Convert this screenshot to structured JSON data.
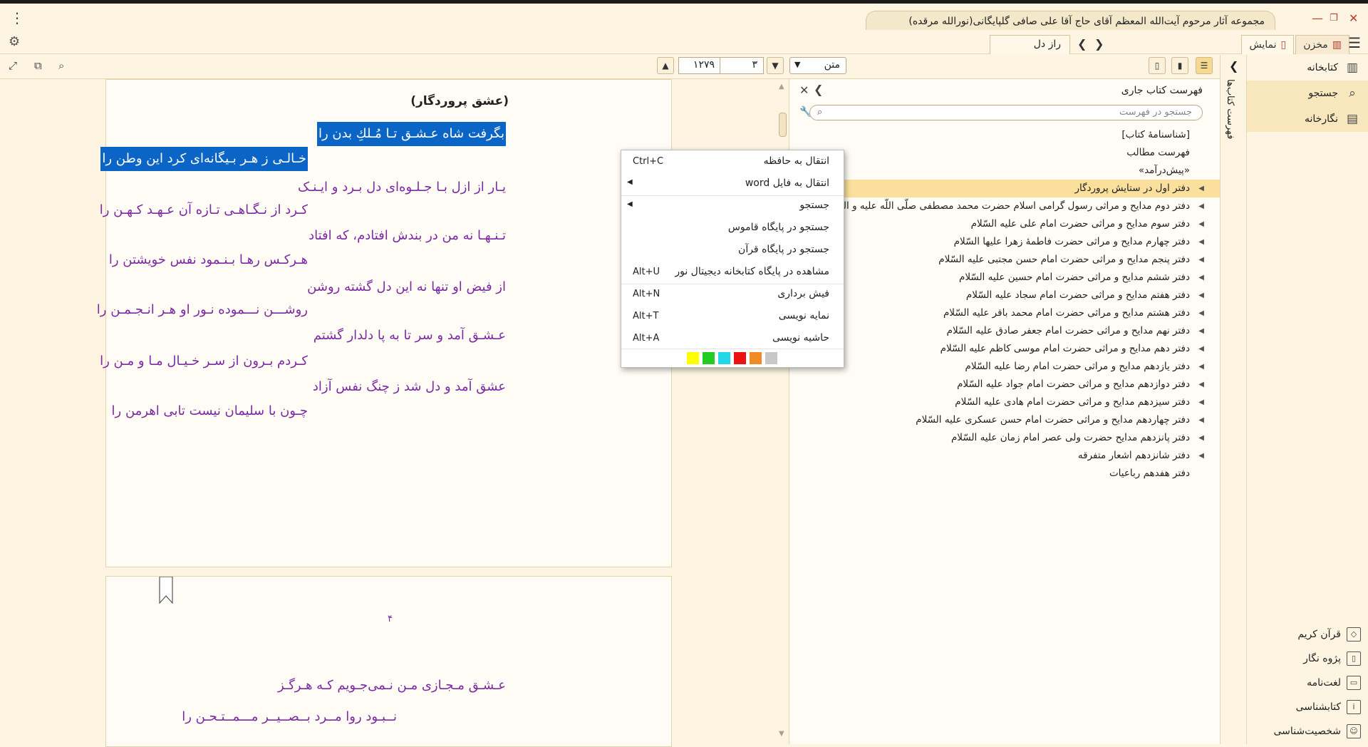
{
  "app": {
    "window_title": "مجموعه آثار مرحوم آیت‌الله المعظم آقای حاج آقا علی صافی گلپایگانی(نورالله مرقده)",
    "new_tab": "+",
    "menu_dots": "⋮"
  },
  "tabs": {
    "storage": "مخزن",
    "display": "نمایش",
    "bookmark_title": "راز دل"
  },
  "toolbar": {
    "view_mode": "متن",
    "page": "۳",
    "volume": "۱۲۷۹"
  },
  "poem": {
    "title": "(عشق پروردگار)",
    "page_number": "۴",
    "lines": [
      {
        "text": "بگرفت شاه عـشـق تـا مُـلكِ بدن را",
        "selected": true
      },
      {
        "text": "خـالـی ز هـر بـیگانه‌ای کرد این وطن را",
        "selected": true
      },
      {
        "text": "یـار از ازل بـا جـلـوه‌ای دل بـرد و ایـنـک",
        "selected": false
      },
      {
        "text": "کـرد از نـگـاهـی تـازه آن عـهـد کـهـن را",
        "selected": false
      },
      {
        "text": "تـنـهـا نه من در بندش افتادم، که افتاد",
        "selected": false
      },
      {
        "text": "هـرکـس رهـا بـنـمود نفس خویشتن را",
        "selected": false
      },
      {
        "text": "از فیض او تنها نه این دل گشته روشن",
        "selected": false
      },
      {
        "text": "روشـــن نـــموده نـور او هـر انـجـمـن را",
        "selected": false
      },
      {
        "text": "عـشـق آمد و سر تا به پا دلدار گشتم",
        "selected": false
      },
      {
        "text": "کـردم بـرون از سـر خـیـال مـا و مـن را",
        "selected": false
      },
      {
        "text": "عشق آمد و دل شد ز چنگ نفس آزاد",
        "selected": false
      },
      {
        "text": "چـون با سلیمان نیست تابی اهرمن را",
        "selected": false
      }
    ],
    "page2_lines": [
      {
        "text": "عـشـق مـجـازی مـن نـمی‌جـویم کـه هـرگـز"
      },
      {
        "text": "نــبـود روا مــرد بــصــیــر مـــمــتـحـن را"
      }
    ]
  },
  "context_menu": {
    "items": [
      {
        "label": "انتقال به حافظه",
        "shortcut": "Ctrl+C",
        "submenu": false
      },
      {
        "label": "انتقال به فایل word",
        "shortcut": "",
        "submenu": true
      },
      {
        "label": "جستجو",
        "shortcut": "",
        "submenu": true
      },
      {
        "label": "جستجو در پایگاه قاموس",
        "shortcut": "",
        "submenu": false
      },
      {
        "label": "جستجو در پایگاه قرآن",
        "shortcut": "",
        "submenu": false
      },
      {
        "label": "مشاهده در پایگاه کتابخانه دیجیتال نور",
        "shortcut": "Alt+U",
        "submenu": false
      },
      {
        "label": "فیش برداری",
        "shortcut": "Alt+N",
        "submenu": false
      },
      {
        "label": "نمایه نویسی",
        "shortcut": "Alt+T",
        "submenu": false
      },
      {
        "label": "حاشیه نویسی",
        "shortcut": "Alt+A",
        "submenu": false
      }
    ],
    "highlight_colors": [
      "#ffff00",
      "#22cc22",
      "#22d8e8",
      "#ee1111",
      "#f08a24",
      "#c8c8c8"
    ]
  },
  "toc": {
    "title": "فهرست کتاب جاری",
    "search_placeholder": "جستجو در فهرست",
    "items": [
      {
        "label": "[شناسنامهٔ کتاب]",
        "expandable": false,
        "highlight": false
      },
      {
        "label": "فهرست مطالب",
        "expandable": false,
        "highlight": false
      },
      {
        "label": "«پیش‌درآمد»",
        "expandable": false,
        "highlight": false
      },
      {
        "label": "دفتر اول در ستایش پروردگار",
        "expandable": true,
        "highlight": true
      },
      {
        "label": "دفتر دوم مدایح و مراثی رسول گرامی اسلام حضرت محمد مصطفی صلّی اللّه علیه و اله و سلّم",
        "expandable": true,
        "highlight": false
      },
      {
        "label": "دفتر سوم مدایح و مراثی حضرت امام علی علیه السّلام",
        "expandable": true,
        "highlight": false
      },
      {
        "label": "دفتر چهارم مدایح و مراثی حضرت فاطمهٔ زهرا علیها السّلام",
        "expandable": true,
        "highlight": false
      },
      {
        "label": "دفتر پنجم مدایح و مراثی حضرت امام حسن مجتبی علیه السّلام",
        "expandable": true,
        "highlight": false
      },
      {
        "label": "دفتر ششم مدایح و مراثی حضرت امام حسین علیه السّلام",
        "expandable": true,
        "highlight": false
      },
      {
        "label": "دفتر هفتم مدایح و مراثی حضرت امام سجاد علیه السّلام",
        "expandable": true,
        "highlight": false
      },
      {
        "label": "دفتر هشتم مدایح و مراثی حضرت امام محمد باقر علیه السّلام",
        "expandable": true,
        "highlight": false
      },
      {
        "label": "دفتر نهم مدایح و مراثی حضرت امام جعفر صادق علیه السّلام",
        "expandable": true,
        "highlight": false
      },
      {
        "label": "دفتر دهم مدایح و مراثی حضرت امام موسی کاظم علیه السّلام",
        "expandable": true,
        "highlight": false
      },
      {
        "label": "دفتر یازدهم مدایح و مراثی حضرت امام رضا علیه السّلام",
        "expandable": true,
        "highlight": false
      },
      {
        "label": "دفتر دوازدهم مدایح و مراثی حضرت امام جواد علیه السّلام",
        "expandable": true,
        "highlight": false
      },
      {
        "label": "دفتر سیزدهم مدایح و مراثی حضرت امام هادی علیه السّلام",
        "expandable": true,
        "highlight": false
      },
      {
        "label": "دفتر چهاردهم مدایح و مراثی حضرت امام حسن عسکری علیه السّلام",
        "expandable": true,
        "highlight": false
      },
      {
        "label": "دفتر پانزدهم مدایح حضرت ولی عصر امام زمان علیه السّلام",
        "expandable": true,
        "highlight": false
      },
      {
        "label": "دفتر شانزدهم اشعار متفرقه",
        "expandable": true,
        "highlight": false
      },
      {
        "label": "دفتر هفدهم رباعیات",
        "expandable": false,
        "highlight": false
      }
    ]
  },
  "vertical_tab": {
    "label": "فهرست کتاب‌ها"
  },
  "sidenav": {
    "top": [
      {
        "label": "کتابخانه",
        "icon": "library-icon"
      },
      {
        "label": "جستجو",
        "icon": "search-icon"
      },
      {
        "label": "نگارخانه",
        "icon": "gallery-icon"
      }
    ],
    "bottom": [
      {
        "label": "قرآن کریم",
        "icon": "quran-icon"
      },
      {
        "label": "پژوه نگار",
        "icon": "research-icon"
      },
      {
        "label": "لغت‌نامه",
        "icon": "dictionary-icon"
      },
      {
        "label": "کتابشناسی",
        "icon": "bibliography-icon"
      },
      {
        "label": "شخصیت‌شناسی",
        "icon": "person-icon"
      }
    ]
  }
}
